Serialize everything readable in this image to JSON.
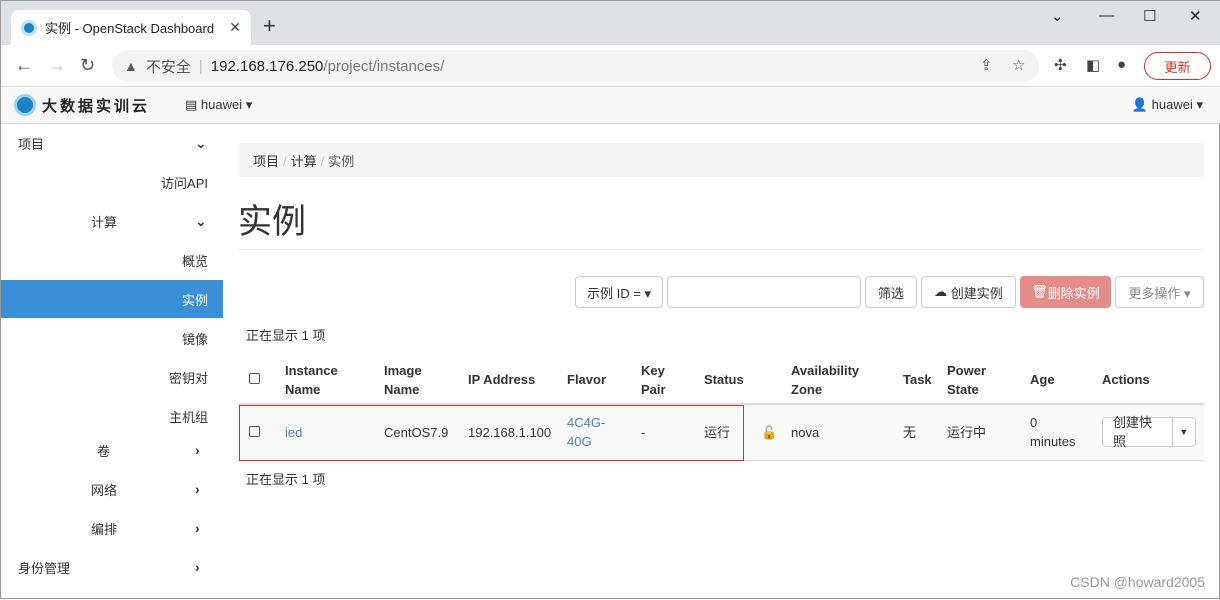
{
  "browser": {
    "tab_title": "实例 - OpenStack Dashboard",
    "url_warning": "不安全",
    "url_host": "192.168.176.250",
    "url_path": "/project/instances/",
    "update_label": "更新"
  },
  "topnav": {
    "brand": "大数据实训云",
    "project": "huawei",
    "user": "huawei"
  },
  "sidebar": {
    "items": [
      {
        "label": "项目",
        "chev": "⌄"
      },
      {
        "label": "访问API"
      },
      {
        "label": "计算",
        "chev": "⌄"
      },
      {
        "label": "概览"
      },
      {
        "label": "实例"
      },
      {
        "label": "镜像"
      },
      {
        "label": "密钥对"
      },
      {
        "label": "主机组"
      },
      {
        "label": "卷",
        "chev": "›"
      },
      {
        "label": "网络",
        "chev": "›"
      },
      {
        "label": "编排",
        "chev": "›"
      },
      {
        "label": "身份管理",
        "chev": "›"
      }
    ]
  },
  "breadcrumb": [
    "项目",
    "计算",
    "实例"
  ],
  "page_title": "实例",
  "toolbar": {
    "filter_field": "示例 ID = ▾",
    "filter_value": "",
    "filter_btn": "筛选",
    "create": "创建实例",
    "delete": "删除实例",
    "more": "更多操作 ▾"
  },
  "count_text": "正在显示 1 项",
  "table": {
    "headers": [
      "Instance Name",
      "Image Name",
      "IP Address",
      "Flavor",
      "Key Pair",
      "Status",
      "",
      "Availability Zone",
      "Task",
      "Power State",
      "Age",
      "Actions"
    ],
    "rows": [
      {
        "name": "ied",
        "image": "CentOS7.9",
        "ip": "192.168.1.100",
        "flavor": "4C4G-40G",
        "keypair": "-",
        "status": "运行",
        "az": "nova",
        "task": "无",
        "power": "运行中",
        "age": "0 minutes",
        "action": "创建快照"
      }
    ]
  },
  "watermark": "CSDN @howard2005"
}
